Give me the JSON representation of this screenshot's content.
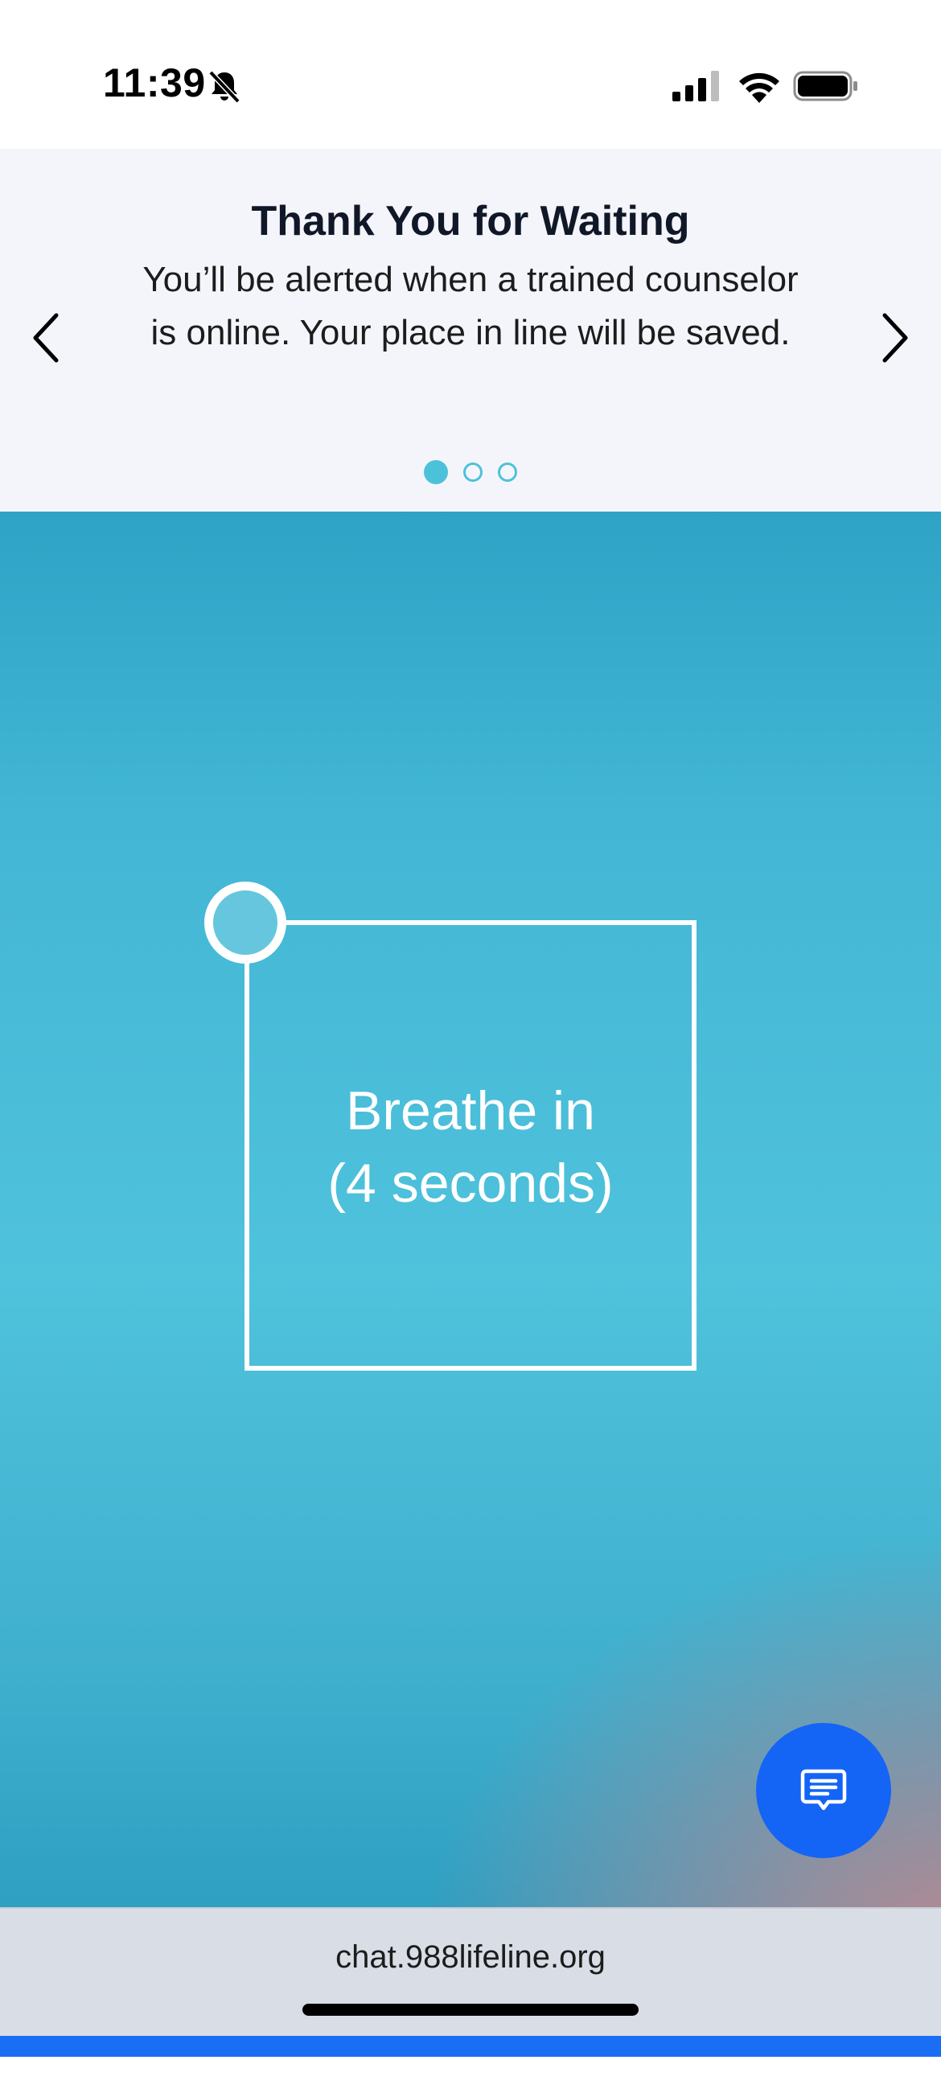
{
  "status_bar": {
    "time": "11:39",
    "icons": [
      "bell-slash-icon",
      "cellular-signal-icon",
      "wifi-icon",
      "battery-icon"
    ]
  },
  "banner": {
    "title": "Thank You for Waiting",
    "body": "You’ll be alerted when a trained counselor is online. Your place in line will be saved.",
    "prev_icon": "chevron-left-icon",
    "next_icon": "chevron-right-icon",
    "pagination": {
      "total": 3,
      "active": 1
    }
  },
  "breathing": {
    "instruction_line1": "Breathe in",
    "instruction_line2": "(4 seconds)"
  },
  "chat_button": {
    "icon": "chat-bubble-icon"
  },
  "browser": {
    "url": "chat.988lifeline.org"
  },
  "colors": {
    "accent_teal": "#4cc2da",
    "chat_blue": "#1464f6",
    "banner_bg": "#f4f5fb"
  }
}
